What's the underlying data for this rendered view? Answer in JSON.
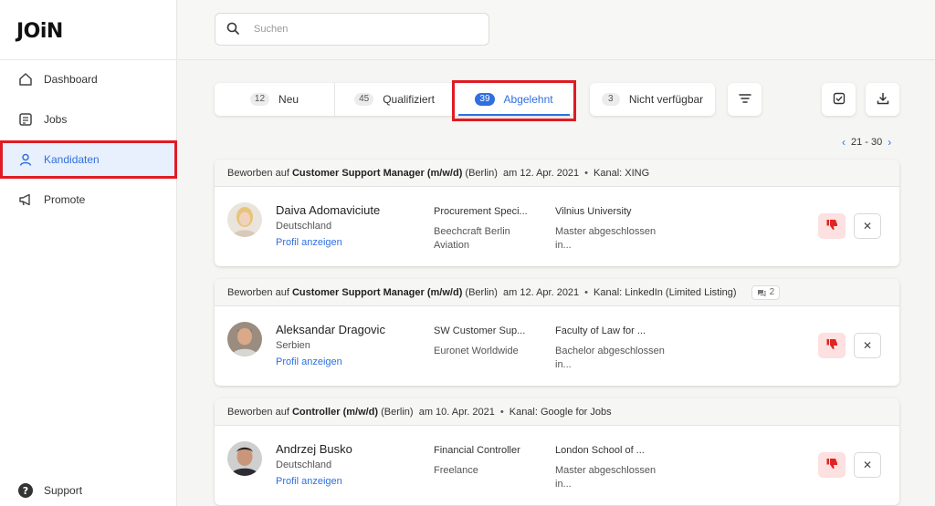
{
  "brand": {
    "logo": "JOiN"
  },
  "sidebar": {
    "items": [
      {
        "label": "Dashboard",
        "icon": "home-icon"
      },
      {
        "label": "Jobs",
        "icon": "jobs-icon"
      },
      {
        "label": "Kandidaten",
        "icon": "user-icon",
        "active": true
      },
      {
        "label": "Promote",
        "icon": "megaphone-icon"
      }
    ],
    "support_label": "Support"
  },
  "search": {
    "placeholder": "Suchen",
    "value": ""
  },
  "tabs": [
    {
      "count": "12",
      "label": "Neu"
    },
    {
      "count": "45",
      "label": "Qualifiziert"
    },
    {
      "count": "39",
      "label": "Abgelehnt",
      "active": true
    },
    {
      "count": "3",
      "label": "Nicht verfügbar"
    }
  ],
  "pager": {
    "range": "21 - 30"
  },
  "colors": {
    "accent": "#2f6fe0",
    "reject_bg": "#fde0e0",
    "reject_icon": "#e02424",
    "highlight": "#e01b24"
  },
  "candidates": [
    {
      "applied_prefix": "Beworben auf",
      "job": "Customer Support Manager (m/w/d)",
      "location": "(Berlin)",
      "date": "am 12. Apr. 2021",
      "channel": "Kanal: XING",
      "messages": "",
      "name": "Daiva Adomaviciute",
      "country": "Deutschland",
      "profile_link": "Profil anzeigen",
      "position": "Procurement Speci...",
      "company": "Beechcraft Berlin Aviation",
      "school": "Vilnius University",
      "degree": "Master abgeschlossen in..."
    },
    {
      "applied_prefix": "Beworben auf",
      "job": "Customer Support Manager (m/w/d)",
      "location": "(Berlin)",
      "date": "am 12. Apr. 2021",
      "channel": "Kanal: LinkedIn (Limited Listing)",
      "messages": "2",
      "name": "Aleksandar Dragovic",
      "country": "Serbien",
      "profile_link": "Profil anzeigen",
      "position": "SW Customer Sup...",
      "company": "Euronet Worldwide",
      "school": "Faculty of Law for ...",
      "degree": "Bachelor abgeschlossen in..."
    },
    {
      "applied_prefix": "Beworben auf",
      "job": "Controller (m/w/d)",
      "location": "(Berlin)",
      "date": "am 10. Apr. 2021",
      "channel": "Kanal: Google for Jobs",
      "messages": "",
      "name": "Andrzej Busko",
      "country": "Deutschland",
      "profile_link": "Profil anzeigen",
      "position": "Financial Controller",
      "company": "Freelance",
      "school": "London School of ...",
      "degree": "Master abgeschlossen in..."
    }
  ]
}
